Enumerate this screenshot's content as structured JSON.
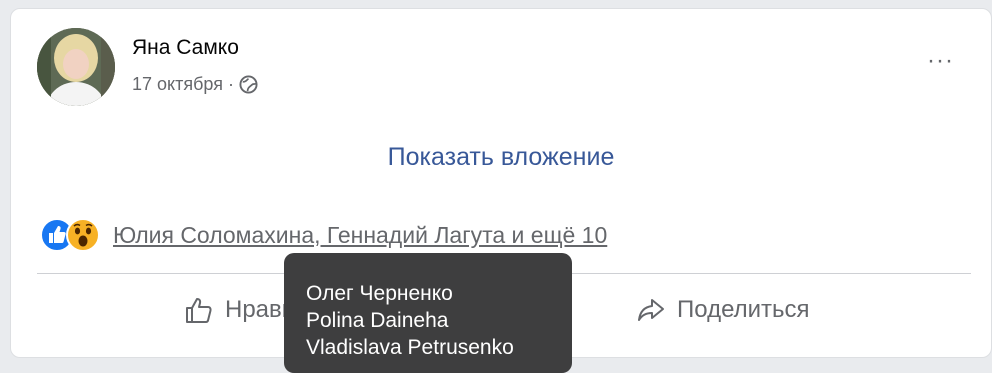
{
  "post": {
    "author": "Яна Самко",
    "date": "17 октября",
    "separator": "·",
    "privacy_icon": "globe-icon",
    "more_label": "···",
    "attachment_link": "Показать вложение",
    "reactions": {
      "icons": [
        "like-reaction-icon",
        "wow-reaction-icon"
      ],
      "names": "Юлия Соломахина, Геннадий Лагута и ещё 10"
    },
    "actions": {
      "like_label": "Нравится",
      "share_label": "Поделиться"
    },
    "tooltip": {
      "names": [
        "Олег Черненко",
        "Polina Daineha",
        "Vladislava Petrusenko"
      ]
    }
  },
  "colors": {
    "link": "#385898",
    "secondary_text": "#65676b",
    "like_blue": "#1877f2",
    "wow_yellow": "#f7b125",
    "tooltip_bg": "#3e3e3f"
  }
}
